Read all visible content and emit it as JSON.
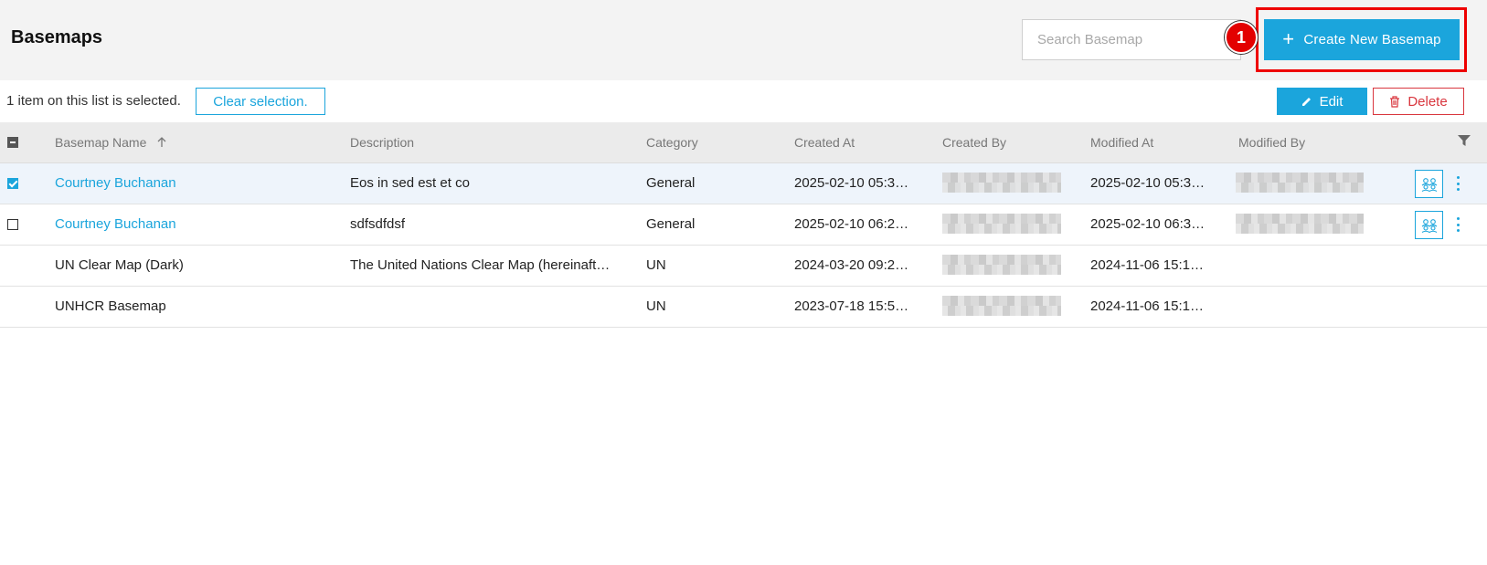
{
  "header": {
    "title": "Basemaps",
    "search_placeholder": "Search Basemap",
    "badge_number": "1",
    "create_label": "Create New Basemap"
  },
  "selection": {
    "status_text": "1 item on this list is selected.",
    "clear_label": "Clear selection.",
    "edit_label": "Edit",
    "delete_label": "Delete"
  },
  "table": {
    "columns": {
      "name": "Basemap Name",
      "description": "Description",
      "category": "Category",
      "created_at": "Created At",
      "created_by": "Created By",
      "modified_at": "Modified At",
      "modified_by": "Modified By"
    },
    "rows": [
      {
        "name": "Courtney Buchanan",
        "description": "Eos in sed est et co",
        "category": "General",
        "created_at": "2025-02-10 05:3…",
        "modified_at": "2025-02-10 05:3…"
      },
      {
        "name": "Courtney Buchanan",
        "description": "sdfsdfdsf",
        "category": "General",
        "created_at": "2025-02-10 06:2…",
        "modified_at": "2025-02-10 06:3…"
      },
      {
        "name": "UN Clear Map (Dark)",
        "description": "The United Nations Clear Map (hereinaft…",
        "category": "UN",
        "created_at": "2024-03-20 09:2…",
        "modified_at": "2024-11-06 15:1…"
      },
      {
        "name": "UNHCR Basemap",
        "description": "",
        "category": "UN",
        "created_at": "2023-07-18 15:5…",
        "modified_at": "2024-11-06 15:1…"
      }
    ]
  },
  "colors": {
    "accent": "#1ba5dc",
    "danger": "#d9363e",
    "highlight": "#ee0000"
  }
}
